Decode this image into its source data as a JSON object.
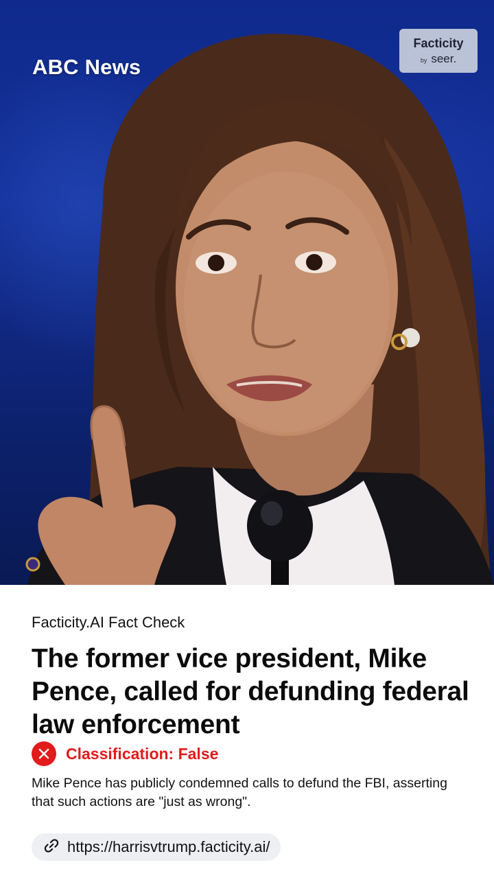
{
  "photo": {
    "source_label": "ABC News",
    "watermark": {
      "name": "Facticity",
      "by": "by",
      "brand": "seer."
    },
    "description_icon": "person-photo"
  },
  "card": {
    "eyebrow": "Facticity.AI Fact Check",
    "headline": "The former vice president, Mike Pence, called for defunding federal law enforcement",
    "classification": {
      "icon": "close-icon",
      "text": "Classification: False",
      "color": "#e21b1b"
    },
    "summary": "Mike Pence has publicly condemned calls to defund the FBI, asserting that such actions are \"just as wrong\".",
    "link": {
      "icon": "link-icon",
      "url": "https://harrisvtrump.facticity.ai/"
    }
  },
  "colors": {
    "background_blue": "#15309a",
    "accent_red": "#e21b1b",
    "pill_gray": "#eeeff3"
  }
}
